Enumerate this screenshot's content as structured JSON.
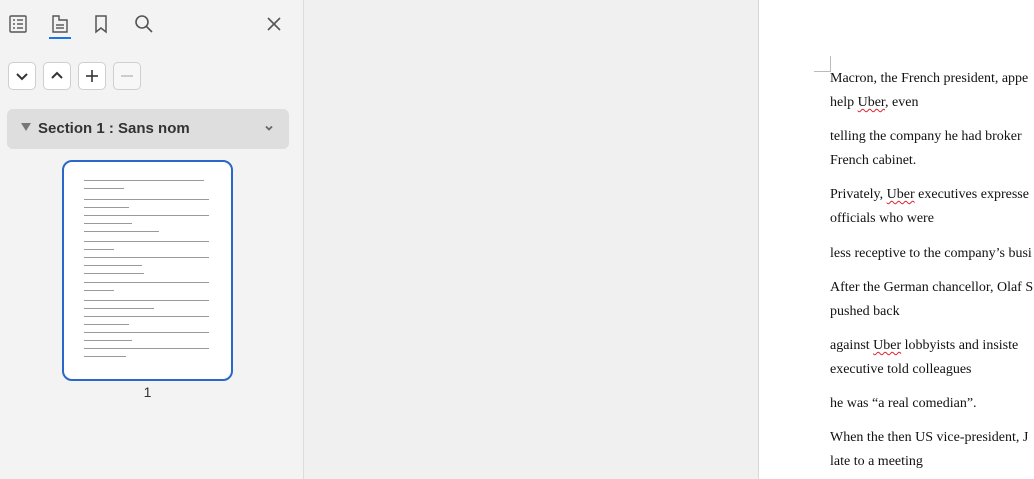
{
  "sidebar": {
    "section_title": "Section 1 : Sans nom",
    "thumbnail_page_number": "1"
  },
  "icons": {
    "toolbar": [
      "toc-icon",
      "pages-icon",
      "bookmark-icon",
      "search-icon",
      "close-icon"
    ],
    "buttons": [
      "chevron-down-icon",
      "chevron-up-icon",
      "plus-icon",
      "minus-icon"
    ]
  },
  "colors": {
    "accent": "#2a67c9",
    "spell_error": "#d23333"
  },
  "document": {
    "lines": [
      {
        "pre": "Macron, the French president, appe",
        "mark": "",
        "post": ""
      },
      {
        "pre": "help ",
        "mark": "Uber",
        "post": ", even"
      },
      {
        "pre": "telling the company he had broker",
        "mark": "",
        "post": ""
      },
      {
        "pre": "French cabinet.",
        "mark": "",
        "post": ""
      },
      {
        "pre": "Privately, ",
        "mark": "Uber",
        "post": " executives  expresse"
      },
      {
        "pre": "officials who were",
        "mark": "",
        "post": ""
      },
      {
        "pre": "less receptive to the company’s busi",
        "mark": "",
        "post": ""
      },
      {
        "pre": "After the German chancellor, Olaf S",
        "mark": "",
        "post": ""
      },
      {
        "pre": "pushed back",
        "mark": "",
        "post": ""
      },
      {
        "pre": "against  ",
        "mark": "Uber",
        "post": "  lobbyists  and  insiste"
      },
      {
        "pre": "executive told colleagues",
        "mark": "",
        "post": ""
      },
      {
        "pre": "he was “a real comedian”.",
        "mark": "",
        "post": ""
      },
      {
        "pre": "When the then US vice-president, J",
        "mark": "",
        "post": ""
      },
      {
        "pre": "late to a meeting",
        "mark": "",
        "post": ""
      }
    ]
  }
}
